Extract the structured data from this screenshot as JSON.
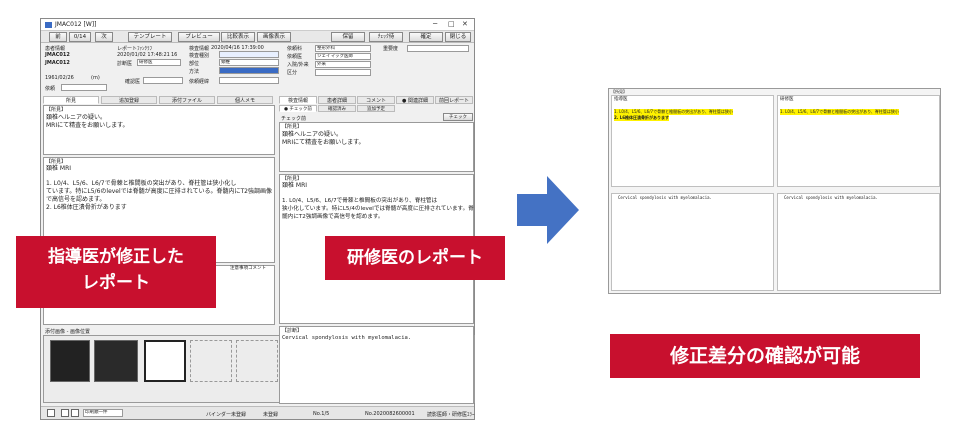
{
  "window": {
    "title": "JMAC012 [W]]",
    "toolbar": {
      "back": "前",
      "page": "0/14",
      "next": "次",
      "template": "テンプレート",
      "preview": "プレビュー",
      "compare": "比較表示",
      "image_display": "画像表示",
      "save": "保留",
      "check": "ﾁｪｯｸ待",
      "confirm": "確定",
      "close": "閉じる"
    },
    "patient": {
      "patient_info_label": "患者情報",
      "patient_id": "JMAC012",
      "patient_name": "JMAC012",
      "birthdate": "1961/02/26",
      "age": "(m)",
      "request_label": "依頼",
      "report_label": "レポートﾌｧﾝｸﾗﾌ",
      "report_date": "2020/01/02 17:48:21",
      "report_no": "16",
      "doctor_label": "診断医",
      "doctor_value": "研修医",
      "exam_info_label": "検査情報",
      "exam_date": "2020/04/16 17:39:00",
      "modality_label": "検査種別",
      "modality_value": "",
      "region_label": "部位",
      "region_value": "頸椎",
      "method_label": "方法",
      "method_value": "",
      "request_dept_label": "依頼科",
      "request_dept_value": "整形外科",
      "request_doc_label": "依頼医",
      "request_doc_value": "ジェイマック医師",
      "inout_label": "入院/外来",
      "inout_value": "外来",
      "section_label": "区分",
      "urgency_label": "重要度",
      "confirmed_by_label": "確認医",
      "comment_label": "依頼経緯"
    },
    "left_tabs": [
      "所見",
      "追加登録",
      "添付ファイル",
      "個人メモ"
    ],
    "right_tabs": [
      "検査情報",
      "患者詳細",
      "コメント",
      "● 関連詳細",
      "前回レポート"
    ],
    "right_subtabs": [
      "● チェック前",
      "確認済み",
      "追加予定"
    ],
    "check_label": "チェック前",
    "check_button": "チェック",
    "left_findings": {
      "header": "【所見】",
      "lines": [
        "頚椎ヘルニアの疑い。",
        "MRIにて精査をお願いします。"
      ]
    },
    "left_impression": {
      "header": "【所見】",
      "title": "頚椎 MRI",
      "lines": [
        "1. L0/4、L5/6、L6/7で骨棘と椎間板の突出があり、脊柱管は狭小化し",
        "ています。特にL5/6のlevelでは脊髄が高度に圧排されている。脊髄内にT2強調画像",
        "で高信号を認めます。",
        "2. L6椎体圧潰骨折があります"
      ]
    },
    "left_bottom_label": "注意事項コメント",
    "left_diagnosis_label": "添付画像 - 画像位置",
    "right_findings": {
      "header": "【所見】",
      "lines": [
        "頚椎ヘルニアの疑い。",
        "MRIにて精査をお願いします。"
      ]
    },
    "right_impression": {
      "header": "【所見】",
      "title": "頚椎 MRI",
      "lines": [
        "1. L0/4、L5/6、L6/7で骨棘と椎間板の突出があり、脊柱管は",
        "狭小化しています。特にL5/4のlevelでは脊髄が高度に圧排されています。脊",
        "髄内にT2強調画像で高信号を認めます。"
      ]
    },
    "right_diagnosis": {
      "header": "【診断】",
      "text": "Cervical spondylosis with myelomalacia."
    },
    "statusbar": {
      "order": "印刷順一件",
      "binder": "バインダー未登録",
      "unreviewed": "未登録",
      "no": "No.1/5",
      "report_no": "No.2020082600001",
      "operator": "読影医師・研修医ｴﾗｰ"
    }
  },
  "callouts": {
    "instructor": [
      "指導医が修正した",
      "レポート"
    ],
    "resident": "研修医のレポート",
    "diff": "修正差分の確認が可能"
  },
  "diff_window": {
    "left_label": "指導医",
    "right_label": "研修医",
    "left_findings_label": "【所見】",
    "left_top_lines": [
      "1. L0/4、L5/6、L6/7で骨棘と椎間板の突出があり、脊柱管は狭小",
      "2. L6椎体圧潰骨折があります"
    ],
    "right_top_lines": [
      "1. L0/4、L5/6、L6/7で骨棘と椎間板の突出があり、脊柱管は狭小"
    ],
    "left_bottom": "Cervical spondylosis with myelomalacia.",
    "right_bottom": "Cervical spondylosis with myelomalacia."
  },
  "colors": {
    "callout_red": "#c8102e",
    "arrow_blue": "#4472c4",
    "highlight_yellow": "#fff200"
  }
}
